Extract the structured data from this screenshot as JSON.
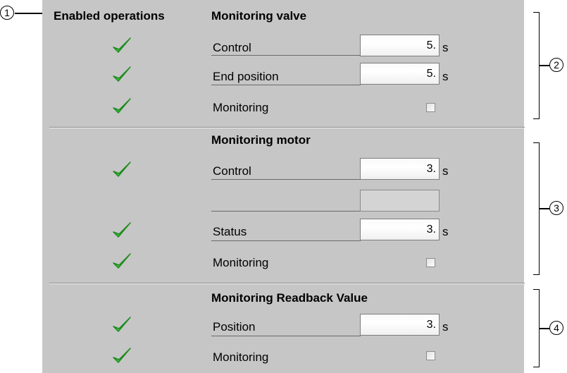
{
  "callouts": [
    "1",
    "2",
    "3",
    "4"
  ],
  "header": {
    "enabled_operations": "Enabled operations"
  },
  "sections": [
    {
      "title": "Monitoring valve",
      "rows": [
        {
          "label": "Control",
          "value": "5.",
          "unit": "s",
          "enabled": true
        },
        {
          "label": "End position",
          "value": "5.",
          "unit": "s",
          "enabled": true
        },
        {
          "label": "Monitoring",
          "checked": false,
          "enabled": true
        }
      ]
    },
    {
      "title": "Monitoring motor",
      "rows": [
        {
          "label": "Control",
          "value": "3.",
          "unit": "s",
          "enabled": true
        },
        {
          "label": "",
          "value": "",
          "unit": "",
          "enabled": false
        },
        {
          "label": "Status",
          "value": "3.",
          "unit": "s",
          "enabled": true
        },
        {
          "label": "Monitoring",
          "checked": false,
          "enabled": true
        }
      ]
    },
    {
      "title": "Monitoring Readback Value",
      "rows": [
        {
          "label": "Position",
          "value": "3.",
          "unit": "s",
          "enabled": true
        },
        {
          "label": "Monitoring",
          "checked": false,
          "enabled": true
        }
      ]
    }
  ],
  "icons": {
    "enabled": "green-check-icon"
  },
  "colors": {
    "panel_bg": "#c6c6c6",
    "check_green": "#3cc63c"
  }
}
